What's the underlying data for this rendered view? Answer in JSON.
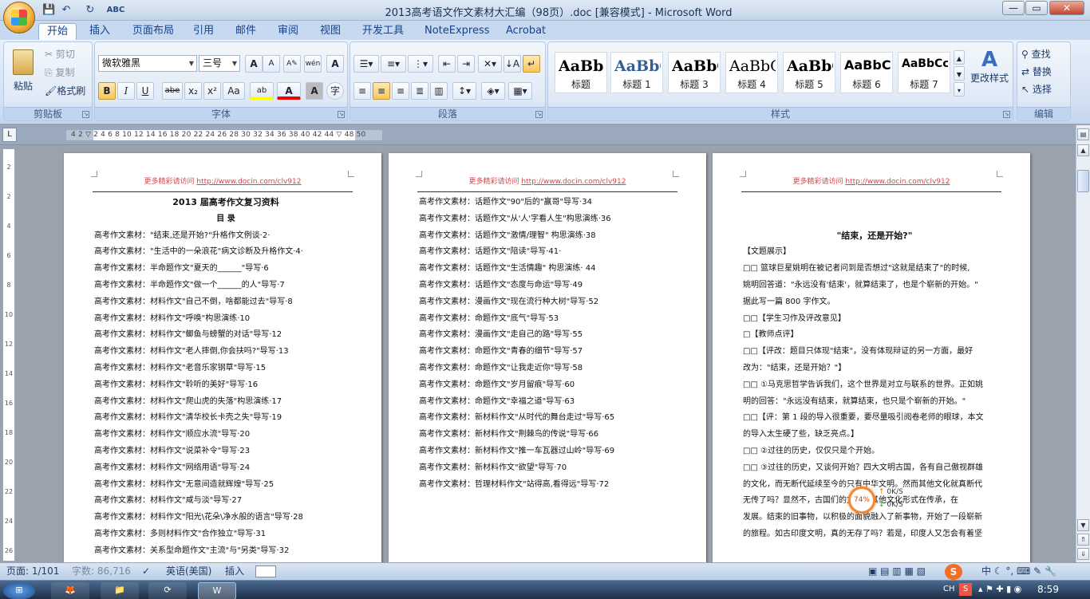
{
  "window": {
    "title": "2013高考语文作文素材大汇编（98页）.doc [兼容模式] - Microsoft Word",
    "controls": {
      "minimize": "—",
      "maximize": "▭",
      "close": "✕"
    }
  },
  "qat": {
    "save": "💾",
    "undo": "↶",
    "redo": "↻",
    "spell": "ABC"
  },
  "tabs": [
    "开始",
    "插入",
    "页面布局",
    "引用",
    "邮件",
    "审阅",
    "视图",
    "开发工具",
    "NoteExpress",
    "Acrobat"
  ],
  "ribbon": {
    "clipboard": {
      "label": "剪贴板",
      "paste": "粘贴",
      "cut": "剪切",
      "copy": "复制",
      "format_painter": "格式刷"
    },
    "font": {
      "label": "字体",
      "font_name": "微软雅黑",
      "font_size": "三号",
      "grow": "A",
      "shrink": "A",
      "bold": "B",
      "italic": "I",
      "underline": "U",
      "strike": "abe",
      "sub": "x₂",
      "sup": "x²",
      "case": "Aa",
      "highlight": "ab",
      "color": "A",
      "charshade": "A",
      "enclose": "字"
    },
    "paragraph": {
      "label": "段落"
    },
    "styles": {
      "label": "样式",
      "items": [
        {
          "sample": "AaBb(",
          "name": "标题"
        },
        {
          "sample": "AaBbC",
          "name": "标题 1"
        },
        {
          "sample": "AaBbC",
          "name": "标题 3"
        },
        {
          "sample": "AaBbC",
          "name": "标题 4"
        },
        {
          "sample": "AaBbC",
          "name": "标题 5"
        },
        {
          "sample": "AaBbCc",
          "name": "标题 6"
        },
        {
          "sample": "AaBbCcD",
          "name": "标题 7"
        }
      ],
      "change": "更改样式"
    },
    "editing": {
      "label": "编辑",
      "find": "查找",
      "replace": "替换",
      "select": "选择"
    }
  },
  "ruler": {
    "ticks": "4   2  ▽  2   4   6   8  10  12  14  16  18  20  22  24  26  28  30  32  34  36  38  40  42  44  ▽  48  50",
    "corner": "L"
  },
  "vruler": [
    "2",
    "2",
    "4",
    "6",
    "8",
    "10",
    "12",
    "14",
    "16",
    "18",
    "20",
    "22",
    "24",
    "26"
  ],
  "header": {
    "prefix": "更多精彩请访问 ",
    "link": "http://www.docin.com/clv912"
  },
  "pages": {
    "p1": {
      "title": "2013 届高考作文复习资料",
      "subtitle": "目  录",
      "lines": [
        "高考作文素材：\"结束,还是开始?\"升格作文例谈·2·",
        "高考作文素材：\"生活中的一朵浪花\"病文诊断及升格作文·4·",
        "高考作文素材：半命题作文\"夏天的______\"导写·6",
        "高考作文素材：半命题作文\"做一个______的人\"导写·7",
        "高考作文素材：材料作文\"自己不倒，啥都能过去\"导写·8",
        "高考作文素材：材料作文\"呼唤\"构思演练·10",
        "高考作文素材：材料作文\"鲫鱼与螃蟹的对话\"导写·12",
        "高考作文素材：材料作文\"老人摔倒,你会扶吗?\"导写·13",
        "高考作文素材：材料作文\"老音乐家钢草\"导写·15",
        "高考作文素材：材料作文\"聆听的美好\"导写·16",
        "高考作文素材：材料作文\"爬山虎的失落\"构思演练·17",
        "高考作文素材：材料作文\"清华校长卡壳之失\"导写·19",
        "高考作文素材：材料作文\"顺应水流\"导写·20",
        "高考作文素材：材料作文\"说菜补令\"导写·23",
        "高考作文素材：材料作文\"网络用语\"导写·24",
        "高考作文素材：材料作文\"无意间造就辉煌\"导写·25",
        "高考作文素材：材料作文\"咸与淡\"导写·27",
        "高考作文素材：材料作文\"阳光\\花朵\\净水般的语言\"导写·28",
        "高考作文素材：多则材料作文\"合作独立\"导写·31",
        "高考作文素材：关系型命题作文\"主流\"与\"另类\"导写·32"
      ]
    },
    "p2": {
      "lines": [
        "高考作文素材：话题作文\"90\"后的\"赢哥\"导写·34",
        "高考作文素材：话题作文\"从'人'字看人生\"构思演练·36",
        "高考作文素材：话题作文\"激情/理智\" 构思演练·38",
        "高考作文素材：话题作文\"陪读\"导写·41·",
        "高考作文素材：话题作文\"生活情趣\" 构思演练· 44",
        "高考作文素材：话题作文\"态度与命运\"导写·49",
        "高考作文素材：漫画作文\"现在流行种大树\"导写·52",
        "高考作文素材：命题作文\"底气\"导写·53",
        "高考作文素材：漫画作文\"走自己的路\"导写·55",
        "高考作文素材：命题作文\"青春的细节\"导写·57",
        "高考作文素材：命题作文\"让我走近你\"导写·58",
        "高考作文素材：命题作文\"岁月留痕\"导写·60",
        "高考作文素材：命题作文\"幸福之道\"导写·63",
        "高考作文素材：新材料作文\"从时代的舞台走过\"导写·65",
        "高考作文素材：新材料作文\"荆棘鸟的传说\"导写·66",
        "高考作文素材：新材料作文\"推一车瓦器过山岭\"导写·69",
        "高考作文素材：新材料作文\"欲望\"导写·70",
        "高考作文素材：哲理材料作文\"站得高,看得远\"导写·72",
        "",
        ""
      ]
    },
    "p3": {
      "title": "\"结束，还是开始?\"",
      "lines": [
        "【文题展示】",
        "□□ 篮球巨星姚明在被记者问到是否想过\"这就是结束了\"的时候,",
        "姚明回答道：\"永远没有'结束'，就算结束了，也是个崭新的开始。\"",
        "据此写一篇 800 字作文。",
        "□□【学生习作及评改意见】",
        "□【教师点评】",
        "□□【评改：题目只体现\"结束\"，没有体现辩证的另一方面，最好",
        "改为：\"结束，还是开始？\"】",
        "□□ ①马克思哲学告诉我们，这个世界是对立与联系的世界。正如姚",
        "明的回答：\"永远没有结束，就算结束，也只是个崭新的开始。\"",
        "□□【评：第 1 段的导入很重要，要尽量吸引阅卷老师的眼球，本文",
        "的导入太生硬了些，缺乏亮点。】",
        "□□ ②过往的历史，仅仅只是个开始。",
        "□□ ③过往的历史，又谈何开始？四大文明古国，各有自己傲视群雄",
        "的文化，而无断代延续至今的只有中华文明。然而其他文化就真断代",
        "无传了吗？显然不，古国们的文明以其他文化形式在传承，在",
        "发展。结束的旧事物，以积极的面貌融入了新事物，开始了一段崭新",
        "的旅程。如古印度文明，真的无存了吗？若是，印度人又怎会有着坚"
      ]
    }
  },
  "net": {
    "percent": "74%",
    "up": "0K/S",
    "down": "0K/S"
  },
  "status": {
    "page": "页面: 1/101",
    "words": "字数: 86,716",
    "lang": "英语(美国)",
    "mode": "插入"
  },
  "taskbar": {
    "ime": "CH",
    "time": "8:59"
  },
  "colors": {
    "accent": "#15428b",
    "ribbon": "#dfe9f6",
    "link": "#dd4444"
  }
}
